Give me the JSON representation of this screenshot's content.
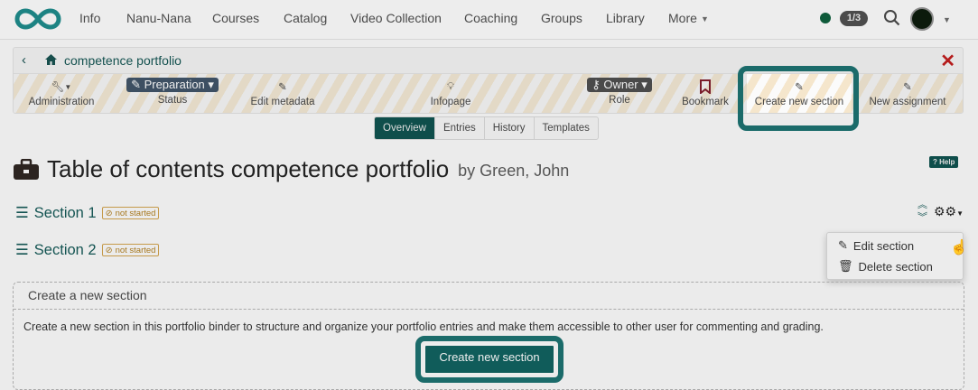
{
  "nav": {
    "items": [
      "Info",
      "Nanu-Nana",
      "Courses",
      "Catalog",
      "Video Collection",
      "Coaching",
      "Groups",
      "Library",
      "More"
    ],
    "badge": "1/3"
  },
  "breadcrumb": {
    "title": "competence portfolio"
  },
  "toolbar": {
    "administration": "Administration",
    "status_value": "Preparation",
    "status": "Status",
    "edit_metadata": "Edit metadata",
    "infopage": "Infopage",
    "role_value": "Owner",
    "role": "Role",
    "bookmark": "Bookmark",
    "create_section": "Create new section",
    "new_assignment": "New assignment"
  },
  "tabs": [
    "Overview",
    "Entries",
    "History",
    "Templates"
  ],
  "page": {
    "title": "Table of contents competence portfolio",
    "by": "by Green, John",
    "help": "Help"
  },
  "sections": [
    {
      "title": "Section 1",
      "status": "not started"
    },
    {
      "title": "Section 2",
      "status": "not started"
    }
  ],
  "menu": {
    "edit": "Edit section",
    "delete": "Delete section"
  },
  "create_box": {
    "header": "Create a new section",
    "description": "Create a new section in this portfolio binder to structure and organize your portfolio entries and make them accessible to other user for commenting and grading.",
    "button": "Create new section"
  },
  "colors": {
    "brand": "#1b6b6a",
    "close": "#b51c1c",
    "status_badge": "#a7781f"
  }
}
